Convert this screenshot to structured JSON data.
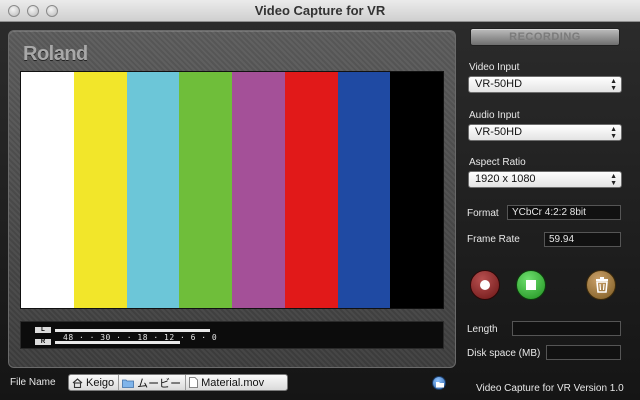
{
  "window": {
    "title": "Video Capture for VR"
  },
  "monitor": {
    "brand": "Roland",
    "color_bars": [
      "#ffffff",
      "#f2e62a",
      "#6cc6d8",
      "#6fbe3a",
      "#a45098",
      "#e11919",
      "#1f4aa3",
      "#000000"
    ],
    "meter": {
      "left_label": "L",
      "right_label": "R",
      "scale": "48 · · 30 · · 18 · 12 · 6 · 0",
      "left_level": 0.47,
      "right_level": 0.38
    }
  },
  "controls": {
    "recording_label": "RECORDING",
    "video_input": {
      "label": "Video Input",
      "value": "VR-50HD"
    },
    "audio_input": {
      "label": "Audio Input",
      "value": "VR-50HD"
    },
    "aspect_ratio": {
      "label": "Aspect Ratio",
      "value": "1920 x 1080"
    },
    "format": {
      "label": "Format",
      "value": "YCbCr 4:2:2 8bit"
    },
    "frame_rate": {
      "label": "Frame Rate",
      "value": "59.94"
    },
    "length": {
      "label": "Length",
      "value": ""
    },
    "disk_space": {
      "label": "Disk space (MB)",
      "value": ""
    }
  },
  "file": {
    "label": "File Name",
    "path": [
      "Keigo",
      "ムービー",
      "Material.mov"
    ]
  },
  "footer": {
    "version": "Video Capture for VR Version 1.0"
  },
  "icons": {
    "close": "close-icon",
    "minimize": "minimize-icon",
    "zoom": "zoom-icon",
    "record": "record-icon",
    "stop": "stop-icon",
    "trash": "trash-icon",
    "home": "home-icon",
    "folder": "folder-icon",
    "document": "document-icon"
  }
}
